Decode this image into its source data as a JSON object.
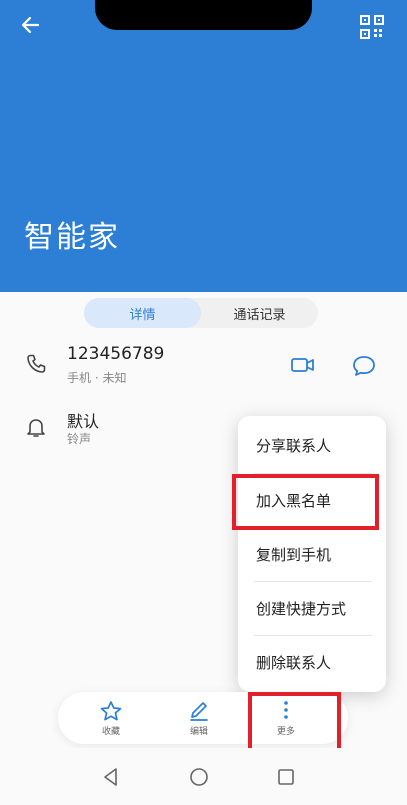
{
  "contact": {
    "name": "智能家"
  },
  "tabs": [
    {
      "label": "详情",
      "active": true
    },
    {
      "label": "通话记录",
      "active": false
    }
  ],
  "phone": {
    "number": "123456789",
    "subtitle": "手机 · 未知"
  },
  "ringtone": {
    "title": "默认",
    "subtitle": "铃声"
  },
  "menu": {
    "items": [
      {
        "label": "分享联系人"
      },
      {
        "label": "加入黑名单"
      },
      {
        "label": "复制到手机"
      },
      {
        "label": "创建快捷方式"
      },
      {
        "label": "删除联系人"
      }
    ]
  },
  "actionbar": {
    "favorite_label": "收藏",
    "edit_label": "编辑",
    "more_label": "更多"
  },
  "colors": {
    "header_blue": "#2d7fd6",
    "highlight_red": "#e0202b",
    "active_tab_bg": "#d9e8fb"
  },
  "icons": {
    "back": "arrow-left-icon",
    "qr": "qr-code-icon",
    "phone": "phone-icon",
    "bell": "bell-icon",
    "video": "video-call-icon",
    "message": "message-icon",
    "star": "star-icon",
    "edit": "pencil-icon",
    "more": "more-vertical-icon"
  }
}
